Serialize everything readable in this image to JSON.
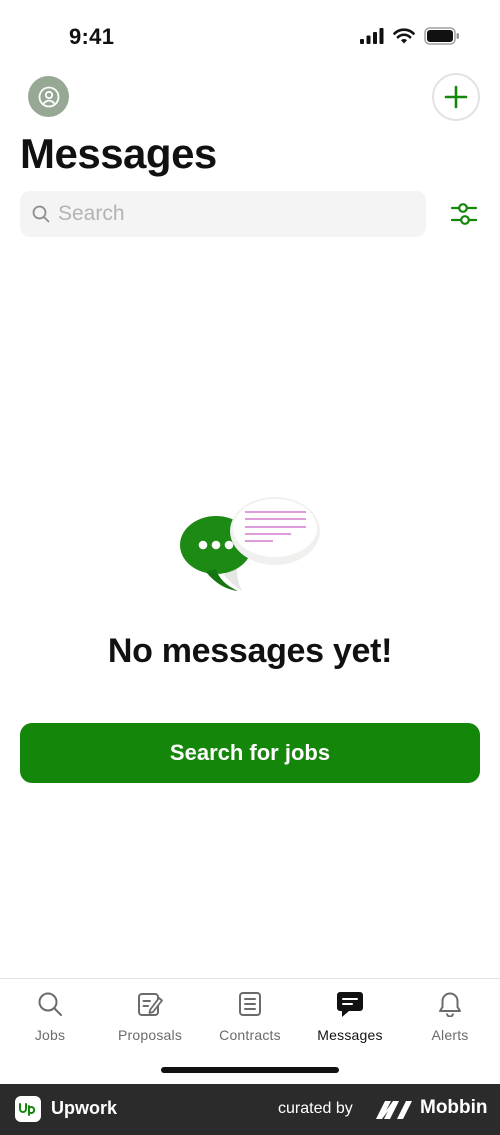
{
  "status_bar": {
    "time": "9:41"
  },
  "header": {
    "title": "Messages"
  },
  "search": {
    "placeholder": "Search",
    "value": ""
  },
  "empty_state": {
    "title": "No messages yet!",
    "button_label": "Search for jobs"
  },
  "tabs": [
    {
      "label": "Jobs",
      "icon": "search-icon",
      "active": false
    },
    {
      "label": "Proposals",
      "icon": "proposals-icon",
      "active": false
    },
    {
      "label": "Contracts",
      "icon": "contracts-icon",
      "active": false
    },
    {
      "label": "Messages",
      "icon": "messages-icon",
      "active": true
    },
    {
      "label": "Alerts",
      "icon": "bell-icon",
      "active": false
    }
  ],
  "footer": {
    "brand": "Upwork",
    "curated_by": "curated by",
    "curator": "Mobbin"
  },
  "colors": {
    "accent": "#14870b",
    "avatar_bg": "#97a895",
    "footer_bg": "#2b2b2b"
  }
}
